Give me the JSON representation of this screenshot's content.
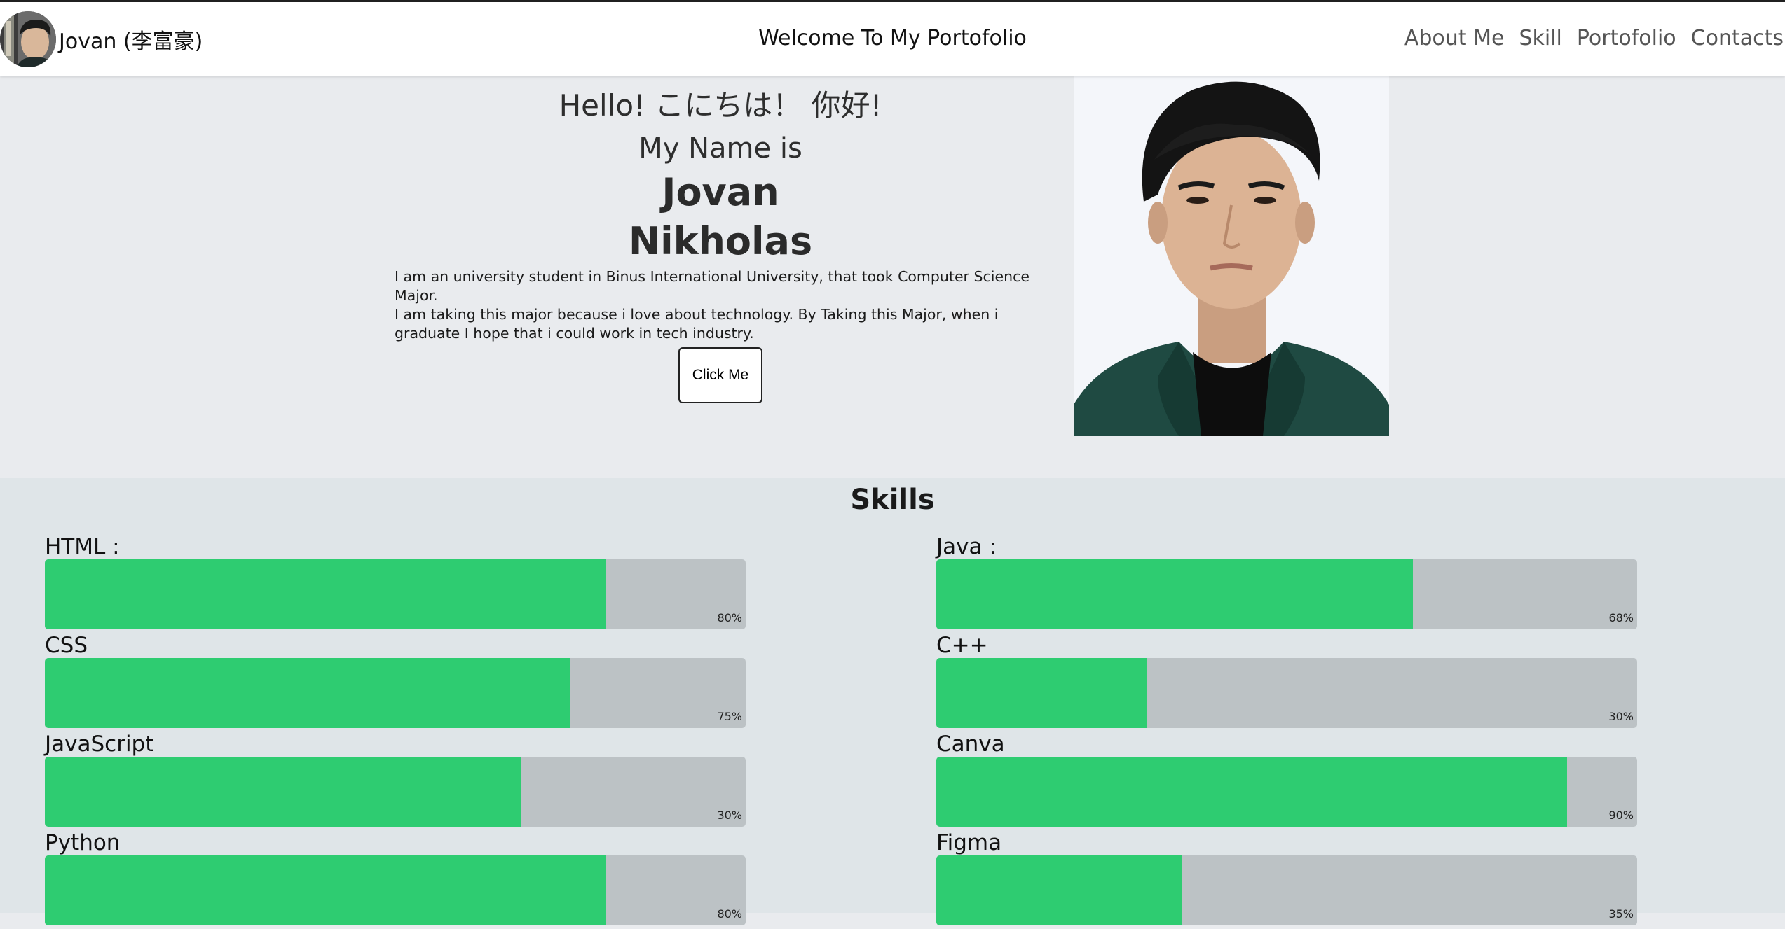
{
  "navbar": {
    "brand_name": "Jovan (李富豪)",
    "center_title": "Welcome To My Portofolio",
    "links": [
      "About Me",
      "Skill",
      "Portofolio",
      "Contacts"
    ]
  },
  "hero": {
    "greeting": "Hello! こにちは！ 你好!",
    "name_intro": "My Name is",
    "first_name": "Jovan",
    "last_name": "Nikholas",
    "bio_line_1": "I am an university student in Binus International University, that took Computer Science Major.",
    "bio_line_2": "I am taking this major because i love about technology. By Taking this Major, when i graduate I hope that i could work in tech industry.",
    "button_label": "Click Me"
  },
  "skills": {
    "title": "Skills",
    "left": [
      {
        "name": "HTML :",
        "fill": 0.8,
        "percent_label": "80%"
      },
      {
        "name": "CSS",
        "fill": 0.75,
        "percent_label": "75%"
      },
      {
        "name": "JavaScript",
        "fill": 0.68,
        "percent_label": "30%"
      },
      {
        "name": "Python",
        "fill": 0.8,
        "percent_label": "80%"
      }
    ],
    "right": [
      {
        "name": "Java :",
        "fill": 0.68,
        "percent_label": "68%"
      },
      {
        "name": "C++",
        "fill": 0.3,
        "percent_label": "30%"
      },
      {
        "name": "Canva",
        "fill": 0.9,
        "percent_label": "90%"
      },
      {
        "name": "Figma",
        "fill": 0.35,
        "percent_label": "35%"
      }
    ]
  },
  "colors": {
    "bar_fill": "#2ecc71",
    "bar_track": "#bcc2c5",
    "hero_bg": "#e9ebee",
    "skills_bg": "#dfe5e8"
  },
  "icons": {
    "avatar": "profile-avatar",
    "photo": "profile-photo"
  }
}
